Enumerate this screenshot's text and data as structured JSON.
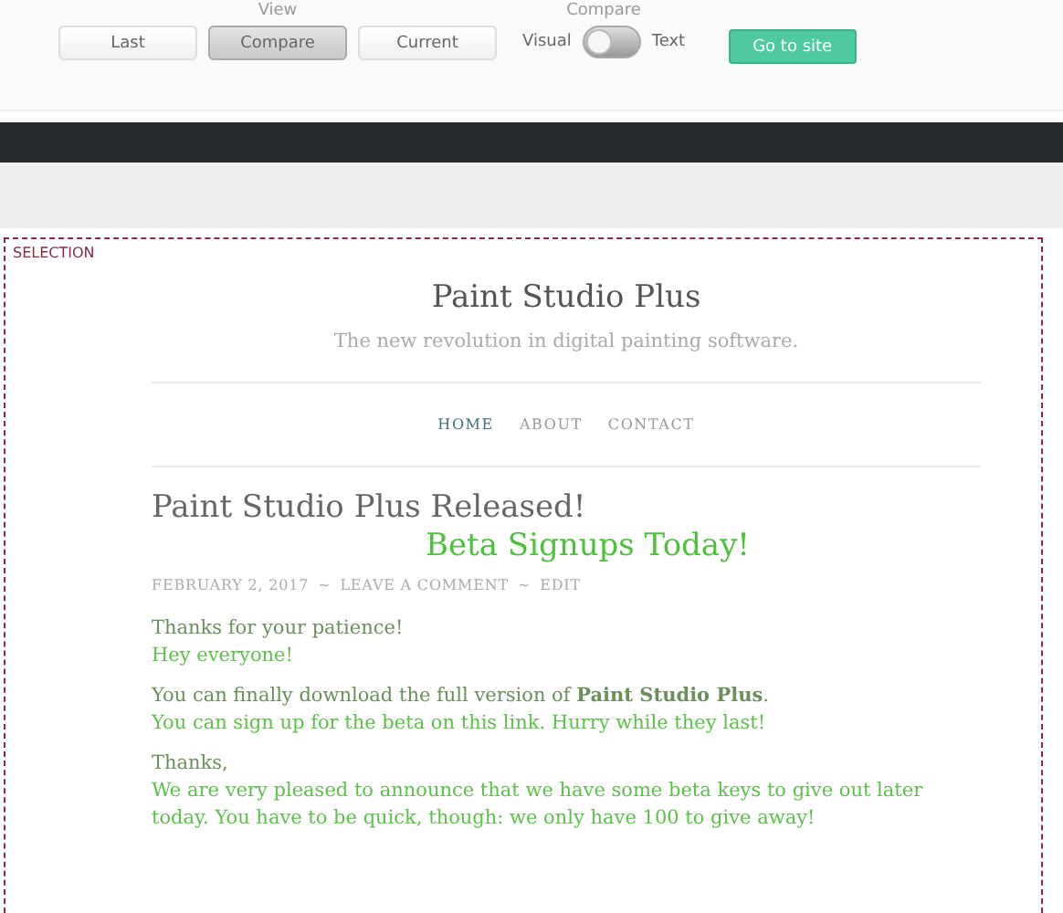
{
  "toolbar": {
    "view_label": "View",
    "view_buttons": [
      {
        "label": "Last",
        "selected": false
      },
      {
        "label": "Compare",
        "selected": true
      },
      {
        "label": "Current",
        "selected": false
      }
    ],
    "compare_label": "Compare",
    "toggle": {
      "left_label": "Visual",
      "right_label": "Text",
      "on": false
    },
    "go_button": "Go to site"
  },
  "selection": {
    "label": "SELECTION"
  },
  "site": {
    "title": "Paint Studio Plus",
    "tagline": "The new revolution in digital painting software.",
    "nav": [
      {
        "label": "HOME",
        "selected": true
      },
      {
        "label": "ABOUT",
        "selected": false
      },
      {
        "label": "CONTACT",
        "selected": false
      }
    ],
    "post_meta": [
      "FEBRUARY 2, 2017",
      "~",
      "LEAVE A COMMENT",
      "~",
      "EDIT"
    ],
    "old_post": {
      "title": "Paint Studio Plus Released!",
      "paragraphs": [
        "Thanks for your patience!",
        "You can finally download the full version of **Paint Studio Plus**.",
        "Thanks,"
      ]
    },
    "new_post": {
      "title": "Beta Signups Today!",
      "paragraphs": [
        "Hey everyone!",
        "You can sign up for the beta on this link. Hurry while they last!",
        "We are very pleased to announce that we have some beta keys to give out later today. You have to be quick, though: we only have 100 to give away!"
      ]
    }
  }
}
